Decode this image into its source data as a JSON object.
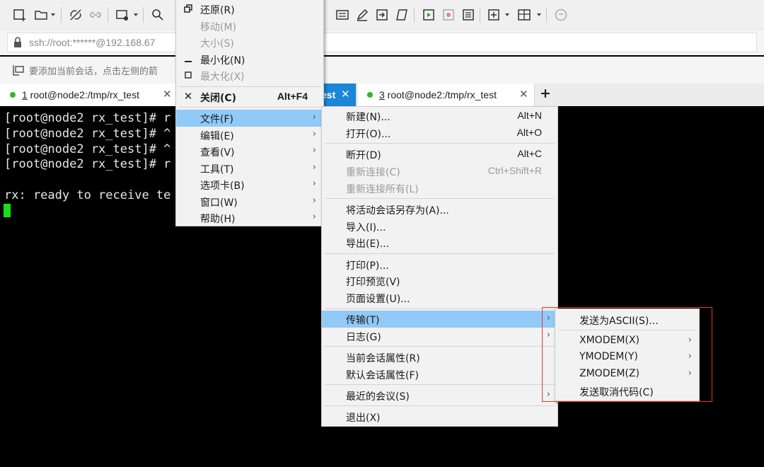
{
  "toolbar": {
    "icons": [
      "new-session-icon",
      "open-folder-icon",
      "disconnect-icon",
      "link-icon",
      "new-window-icon",
      "find-icon",
      "keymap-icon",
      "edit-icon",
      "transfer-icon",
      "sftp-icon",
      "script-icon",
      "record-icon",
      "log-icon",
      "add-pane-icon",
      "layout-icon",
      "help-icon"
    ]
  },
  "address": {
    "text": "ssh://root:******@192.168.67"
  },
  "hint": {
    "text": "要添加当前会话，点击左侧的箭"
  },
  "tabs": [
    {
      "num": "1",
      "title": " root@node2:/tmp/rx_test",
      "close": "✕"
    },
    {
      "title": "est",
      "close": "✕"
    },
    {
      "num": "3",
      "title": " root@node2:/tmp/rx_test",
      "close": "✕"
    }
  ],
  "new_tab": "+",
  "terminal": {
    "lines": [
      "[root@node2 rx_test]# r",
      "[root@node2 rx_test]# ^",
      "[root@node2 rx_test]# ^",
      "[root@node2 rx_test]# r",
      "",
      "rx: ready to receive te"
    ]
  },
  "sysmenu": {
    "items": [
      {
        "label": "还原(R)",
        "icon": "restore-icon"
      },
      {
        "label": "移动(M)",
        "disabled": true
      },
      {
        "label": "大小(S)",
        "disabled": true
      },
      {
        "label": "最小化(N)",
        "icon": "minimize-icon"
      },
      {
        "label": "最大化(X)",
        "icon": "maximize-icon",
        "disabled": true
      },
      {
        "label": "关闭(C)",
        "icon": "close-icon",
        "shortcut": "Alt+F4"
      },
      {
        "label": "文件(F)"
      },
      {
        "label": "编辑(E)"
      },
      {
        "label": "查看(V)"
      },
      {
        "label": "工具(T)"
      },
      {
        "label": "选项卡(B)"
      },
      {
        "label": "窗口(W)"
      },
      {
        "label": "帮助(H)"
      }
    ]
  },
  "filemenu": {
    "items": [
      {
        "label": "新建(N)...",
        "shortcut": "Alt+N"
      },
      {
        "label": "打开(O)...",
        "shortcut": "Alt+O"
      },
      {
        "label": "断开(D)",
        "shortcut": "Alt+C"
      },
      {
        "label": "重新连接(C)",
        "shortcut": "Ctrl+Shift+R",
        "disabled": true
      },
      {
        "label": "重新连接所有(L)",
        "disabled": true
      },
      {
        "label": "将活动会话另存为(A)..."
      },
      {
        "label": "导入(I)..."
      },
      {
        "label": "导出(E)..."
      },
      {
        "label": "打印(P)..."
      },
      {
        "label": "打印预览(V)"
      },
      {
        "label": "页面设置(U)..."
      },
      {
        "label": "传输(T)"
      },
      {
        "label": "日志(G)"
      },
      {
        "label": "当前会话属性(R)"
      },
      {
        "label": "默认会话属性(F)"
      },
      {
        "label": "最近的会议(S)"
      },
      {
        "label": "退出(X)"
      }
    ]
  },
  "transfermenu": {
    "items": [
      {
        "label": "发送为ASCII(S)..."
      },
      {
        "label": "XMODEM(X)"
      },
      {
        "label": "YMODEM(Y)"
      },
      {
        "label": "ZMODEM(Z)"
      },
      {
        "label": "发送取消代码(C)"
      }
    ]
  },
  "arrow": "›",
  "colors": {
    "highlight": "#91c9f7",
    "annotation": "#e33333",
    "cursor": "#18e018",
    "status_dot": "#2fb72f"
  }
}
